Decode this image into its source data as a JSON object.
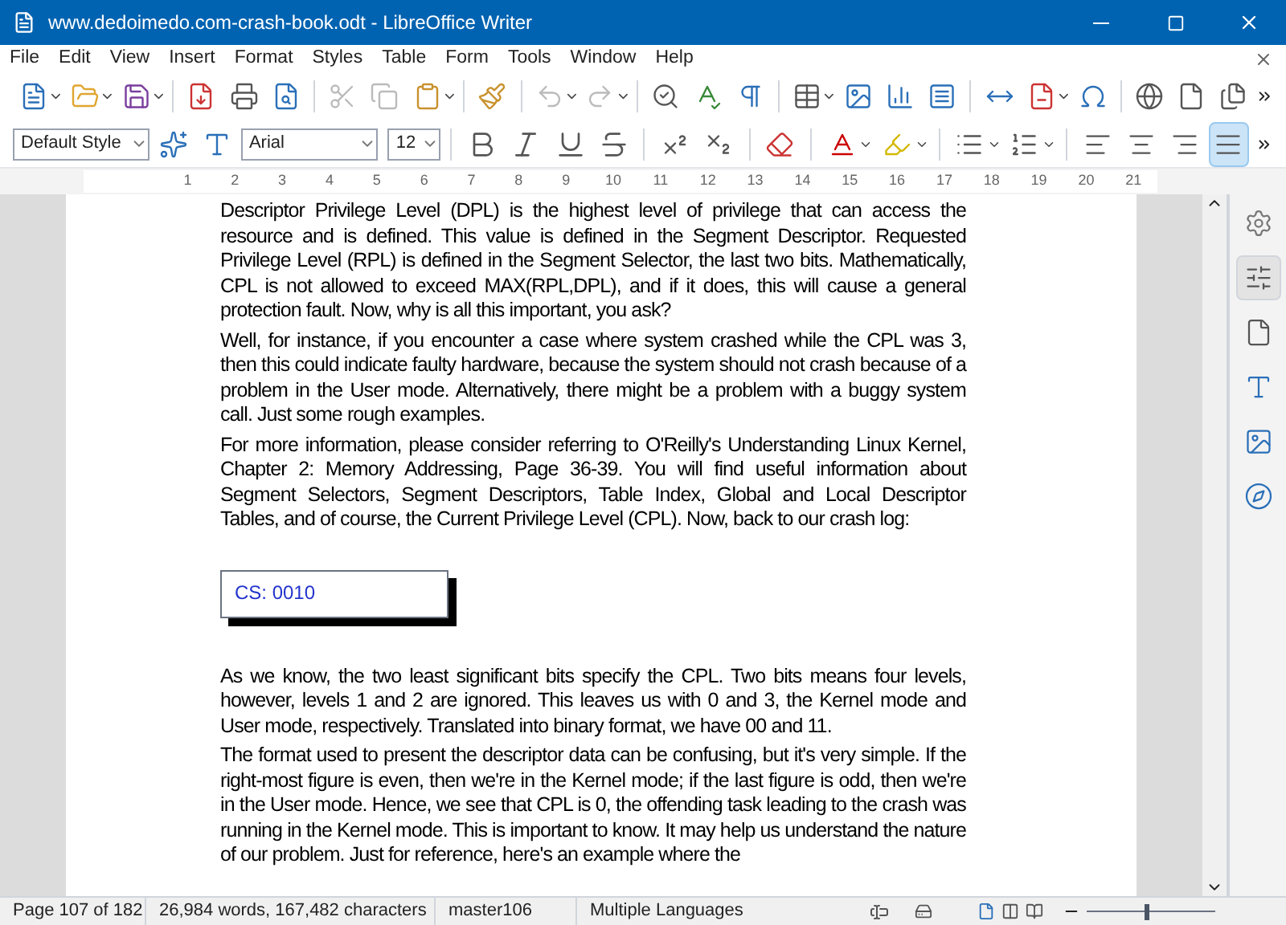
{
  "window": {
    "title": "www.dedoimedo.com-crash-book.odt - LibreOffice Writer"
  },
  "menu": [
    "File",
    "Edit",
    "View",
    "Insert",
    "Format",
    "Styles",
    "Table",
    "Form",
    "Tools",
    "Window",
    "Help"
  ],
  "formatting": {
    "paragraph_style": "Default Style",
    "font": "Arial",
    "size": "12",
    "alignment": [
      {
        "selected": false
      },
      {
        "selected": false
      },
      {
        "selected": false
      },
      {
        "selected": true
      }
    ]
  },
  "ruler": [
    "1",
    "2",
    "3",
    "4",
    "5",
    "6",
    "7",
    "8",
    "9",
    "10",
    "11",
    "12",
    "13",
    "14",
    "15",
    "16",
    "17",
    "18",
    "19",
    "20",
    "21"
  ],
  "document": {
    "blocks": [
      {
        "kind": "paragraph",
        "text": "Descriptor Privilege Level (DPL) is the highest level of privilege that can access the resource and is defined.  This value is defined in the Segment Descriptor.  Requested Privilege Level (RPL) is defined in the Segment Selector, the last two bits.  Mathematically, CPL is not allowed to exceed MAX(RPL,DPL), and if it does, this will cause a general protection fault. Now, why is all this important, you ask?"
      },
      {
        "kind": "paragraph",
        "text": "Well, for instance, if you encounter a case where system crashed while the CPL was 3, then this could indicate faulty hardware, because the system should not crash because of a problem in the User mode.  Alternatively, there might be a problem with a buggy system call. Just some rough examples."
      },
      {
        "kind": "paragraph",
        "text": "For more information, please consider referring to O'Reilly's Understanding Linux Kernel, Chapter 2: Memory Addressing, Page 36-39. You will find useful information about Segment Selectors, Segment Descriptors, Table Index, Global and Local Descriptor Tables, and of course, the Current Privilege Level (CPL). Now, back to our crash log:"
      },
      {
        "kind": "textbox",
        "text": "CS: 0010"
      },
      {
        "kind": "paragraph",
        "text": "As we know, the two least significant bits specify the CPL. Two bits means four levels, however, levels 1 and 2 are ignored.  This leaves us with 0 and 3, the Kernel mode and User mode, respectively. Translated into binary format, we have 00 and 11."
      },
      {
        "kind": "paragraph",
        "text": "The format used to present the descriptor data can be confusing, but it's very simple. If the right-most figure is even, then we're in the Kernel mode; if the last figure is odd, then we're in the User mode. Hence, we see that CPL is 0, the offending task leading to  the crash was running in the Kernel mode.  This is important to know.  It may help us understand the nature of our problem.  Just for reference, here's an example where the"
      }
    ]
  },
  "sidebar": [
    {
      "selected": false
    },
    {
      "selected": true
    },
    {
      "selected": false
    },
    {
      "selected": false
    },
    {
      "selected": false
    },
    {
      "selected": false
    }
  ],
  "status_bar": {
    "page": "Page 107 of 182",
    "counts": "26,984 words, 167,482 characters",
    "page_style": "master106",
    "language": "Multiple Languages",
    "zoom": {
      "level": 0.45
    }
  }
}
